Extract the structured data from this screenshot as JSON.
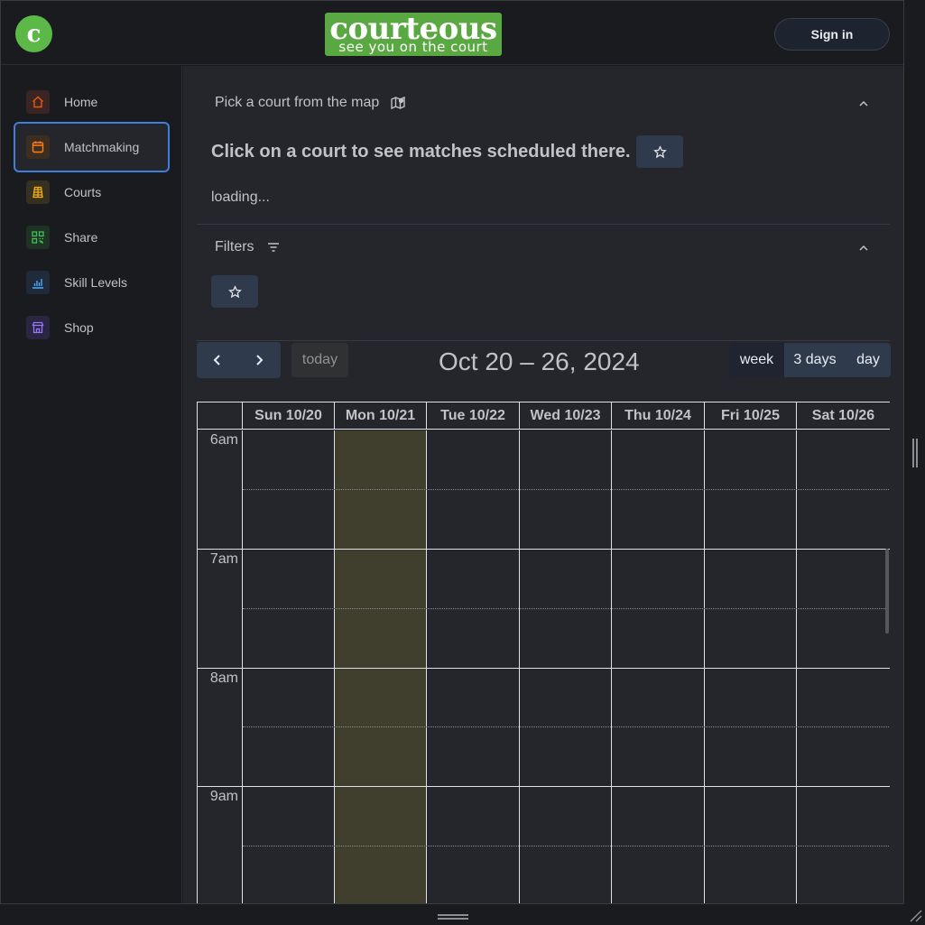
{
  "header": {
    "logo_letter": "c",
    "brand_name": "courteous",
    "brand_tagline": "see you on the court",
    "sign_in_label": "Sign in"
  },
  "sidebar": {
    "items": [
      {
        "label": "Home",
        "icon": "home-icon",
        "color": "#e8590c",
        "bg": "#3a2424"
      },
      {
        "label": "Matchmaking",
        "icon": "calendar-icon",
        "color": "#fd7e14",
        "bg": "#3d2e22",
        "active": true
      },
      {
        "label": "Courts",
        "icon": "court-icon",
        "color": "#fab005",
        "bg": "#35301f"
      },
      {
        "label": "Share",
        "icon": "qr-code-icon",
        "color": "#40c057",
        "bg": "#1f3324"
      },
      {
        "label": "Skill Levels",
        "icon": "chart-icon",
        "color": "#4dabf7",
        "bg": "#1f2a3a"
      },
      {
        "label": "Shop",
        "icon": "store-icon",
        "color": "#9775fa",
        "bg": "#2a2540"
      }
    ]
  },
  "map_section": {
    "title": "Pick a court from the map",
    "court_prompt": "Click on a court to see matches scheduled there.",
    "loading_text": "loading..."
  },
  "filters_section": {
    "title": "Filters"
  },
  "calendar": {
    "today_label": "today",
    "range_title": "Oct 20 – 26, 2024",
    "views": [
      "week",
      "3 days",
      "day"
    ],
    "selected_view": "week",
    "days": [
      "Sun 10/20",
      "Mon 10/21",
      "Tue 10/22",
      "Wed 10/23",
      "Thu 10/24",
      "Fri 10/25",
      "Sat 10/26"
    ],
    "today_day": "Mon 10/21",
    "time_labels": [
      "6am",
      "7am",
      "8am",
      "9am"
    ],
    "today_highlight_color": "#403e2d"
  }
}
